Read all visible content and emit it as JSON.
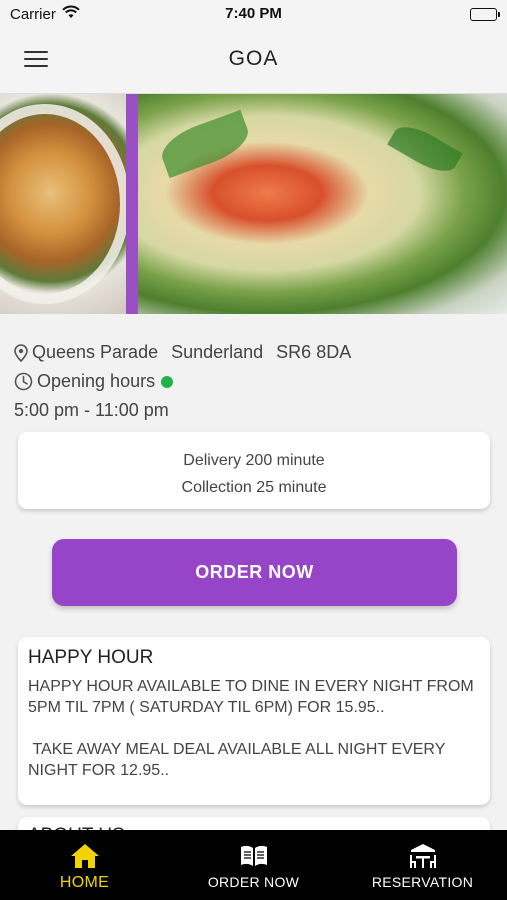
{
  "status_bar": {
    "carrier": "Carrier",
    "time": "7:40 PM"
  },
  "header": {
    "title": "GOA",
    "menu_icon": "hamburger-menu-icon"
  },
  "restaurant": {
    "address_parts": [
      "Queens Parade",
      "Sunderland",
      "SR6 8DA"
    ],
    "opening_label": "Opening hours",
    "opening_times": "5:00 pm - 11:00 pm",
    "open_status_color": "#22b14c"
  },
  "delivery": {
    "delivery_text": "Delivery 200 minute",
    "collection_text": "Collection 25 minute"
  },
  "order_button": {
    "label": "ORDER NOW",
    "color": "#9645c9"
  },
  "promo": {
    "title": "HAPPY HOUR",
    "paragraphs": [
      "HAPPY HOUR AVAILABLE TO DINE IN EVERY NIGHT FROM 5PM TIL 7PM ( SATURDAY TIL 6PM) FOR 15.95..",
      " TAKE AWAY MEAL DEAL AVAILABLE ALL NIGHT EVERY NIGHT FOR 12.95.."
    ]
  },
  "next_section": {
    "title": "ABOUT US"
  },
  "tabs": [
    {
      "label": "HOME",
      "icon": "home-icon",
      "active": true
    },
    {
      "label": "ORDER NOW",
      "icon": "menu-book-icon",
      "active": false
    },
    {
      "label": "RESERVATION",
      "icon": "reservation-table-icon",
      "active": false
    }
  ],
  "colors": {
    "accent": "#9645c9",
    "active_tab": "#f2d300",
    "tab_bar_bg": "#000000"
  }
}
